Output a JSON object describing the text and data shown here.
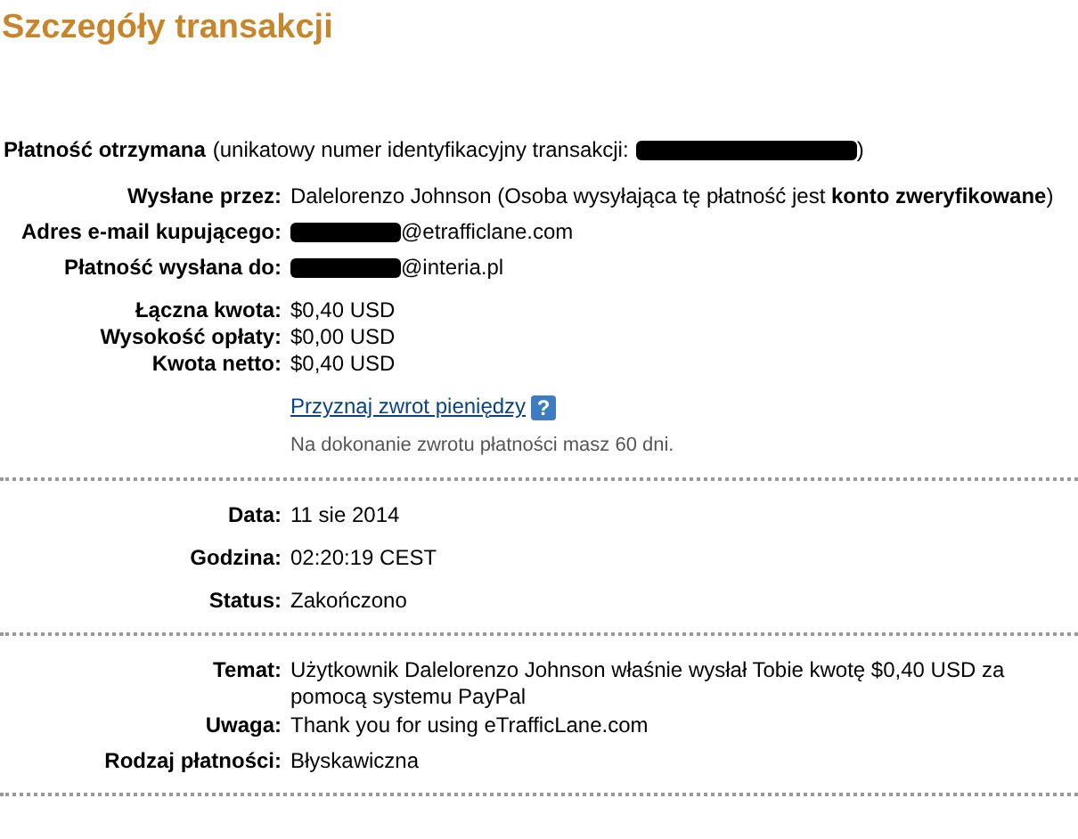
{
  "title": "Szczegóły transakcji",
  "received": {
    "label": "Płatność otrzymana",
    "text_before": "(unikatowy numer identyfikacyjny transakcji:",
    "text_after": ")"
  },
  "section_1": {
    "groups": [
      {
        "rows": [
          {
            "kind": "text",
            "label": "Wysłane przez:",
            "value": "Dalelorenzo Johnson (Osoba wysyłająca tę płatność jest **konto zweryfikowane**)"
          },
          {
            "kind": "masked",
            "label": "Adres e-mail kupującego:",
            "value": "@etrafficlane.com"
          },
          {
            "kind": "masked",
            "label": "Płatność wysłana do:",
            "value": "@interia.pl"
          }
        ]
      },
      {
        "rows": [
          {
            "kind": "text",
            "label": "Łączna kwota:",
            "value": "$0,40 USD"
          },
          {
            "kind": "text",
            "label": "Wysokość opłaty:",
            "value": "$0,00 USD"
          },
          {
            "kind": "text",
            "label": "Kwota netto:",
            "value": "$0,40 USD"
          }
        ]
      }
    ],
    "refund_link": "Przyznaj zwrot pieniędzy",
    "refund_help": "?",
    "refund_note": "Na dokonanie zwrotu płatności masz 60 dni."
  },
  "section_2": {
    "rows": [
      {
        "kind": "text",
        "label": "Data:",
        "value": "11 sie 2014"
      },
      {
        "kind": "text",
        "label": "Godzina:",
        "value": "02:20:19 CEST"
      },
      {
        "kind": "text",
        "label": "Status:",
        "value": "Zakończono"
      }
    ]
  },
  "section_3": {
    "rows": [
      {
        "kind": "text",
        "label": "Temat:",
        "value": "Użytkownik Dalelorenzo Johnson właśnie wysłał Tobie kwotę $0,40 USD za pomocą systemu PayPal"
      },
      {
        "kind": "text",
        "label": "Uwaga:",
        "value": "Thank you for using eTrafficLane.com"
      },
      {
        "kind": "text",
        "label": "Rodzaj płatności:",
        "value": "Błyskawiczna"
      }
    ]
  }
}
